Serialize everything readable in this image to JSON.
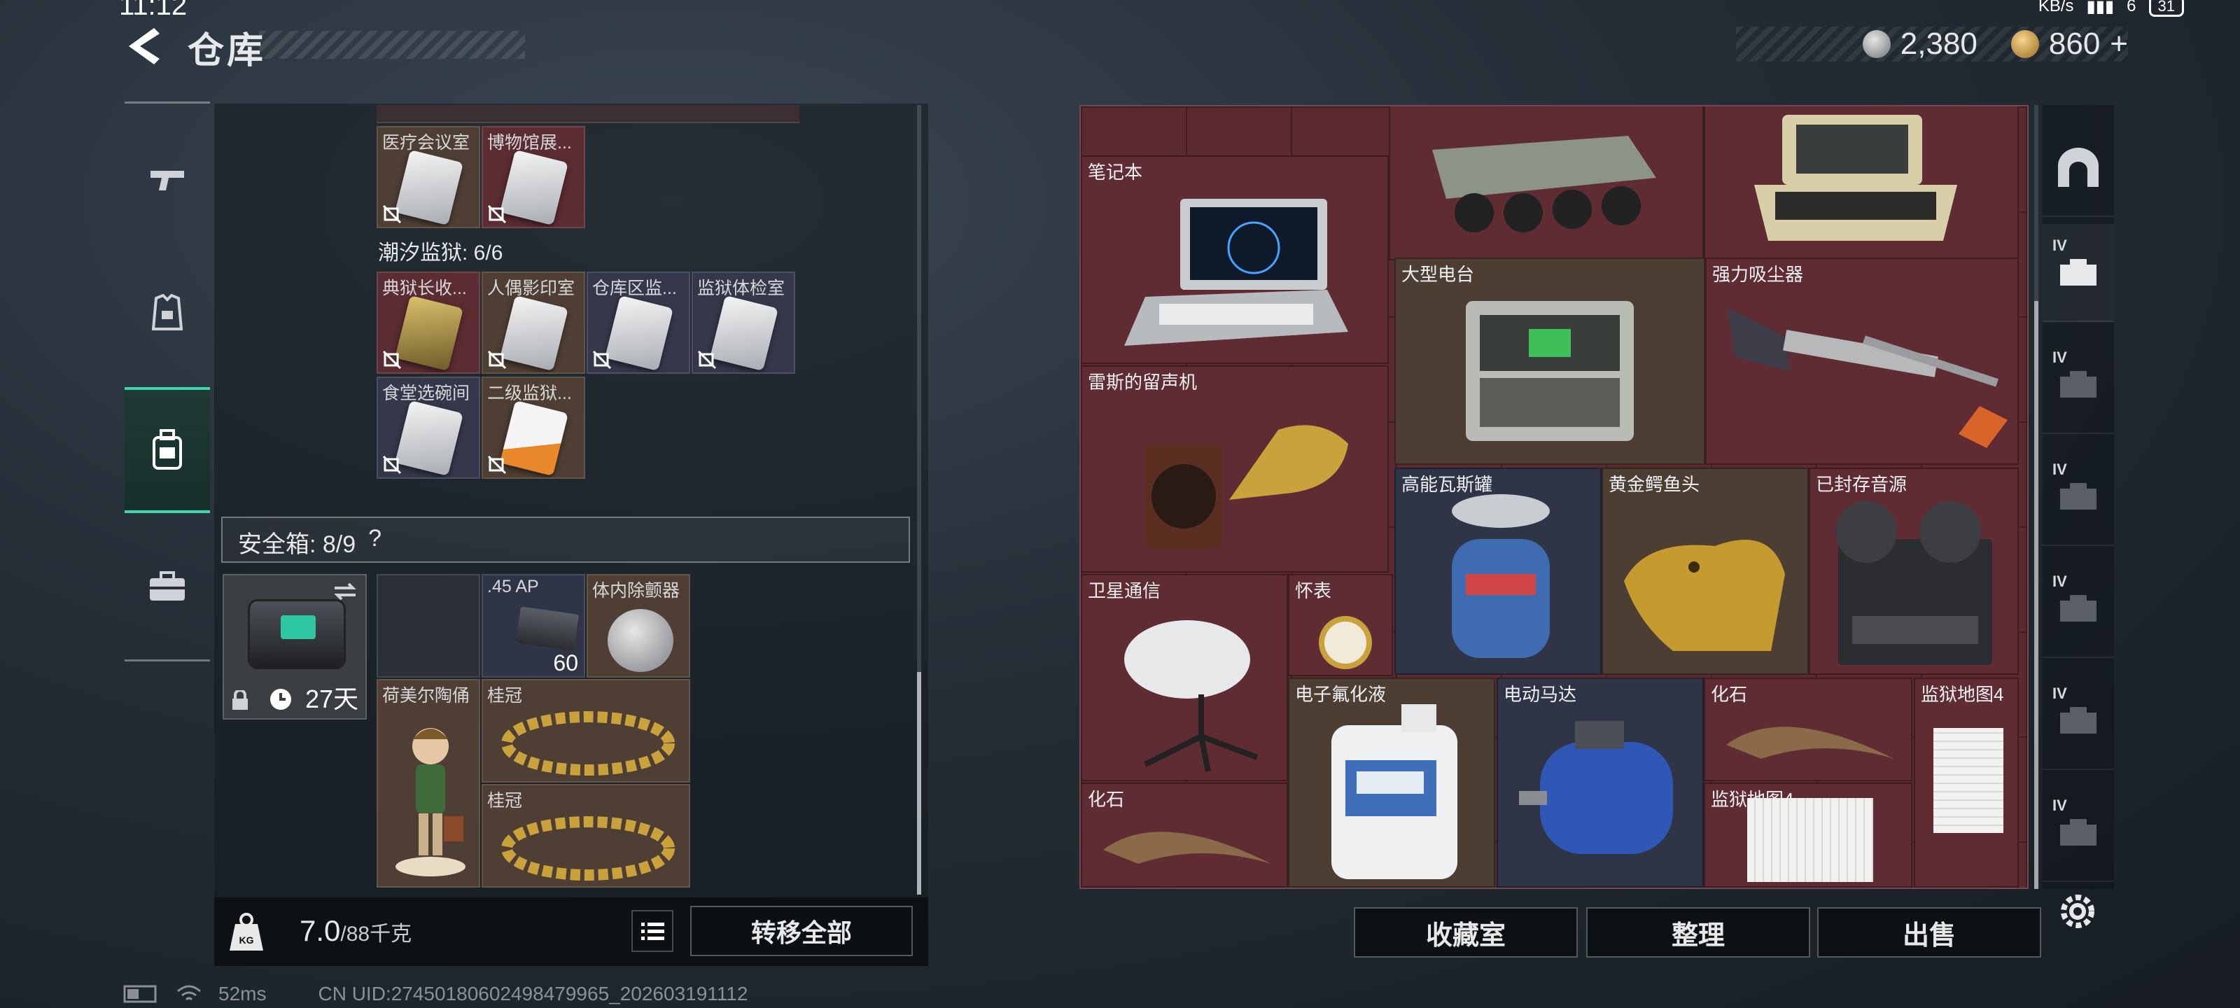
{
  "status": {
    "time": "11:12",
    "net": "KB/s",
    "signal_bars": "6",
    "battery": "31"
  },
  "header": {
    "title": "仓库"
  },
  "currency": {
    "silver": "2,380",
    "gold": "860",
    "gold_plus": "+"
  },
  "left_nav": {
    "items": [
      {
        "icon": "gun-icon"
      },
      {
        "icon": "armor-icon"
      },
      {
        "icon": "backpack-icon",
        "active": true
      },
      {
        "icon": "briefcase-icon"
      }
    ]
  },
  "keycards": {
    "top_row": [
      {
        "label": "医疗会议室",
        "color": "brown"
      },
      {
        "label": "博物馆展...",
        "color": "red"
      }
    ],
    "section_title": "潮汐监狱: 6/6",
    "prison_rows": [
      [
        {
          "label": "典狱长收...",
          "color": "red",
          "card": "gold"
        },
        {
          "label": "人偶影印室",
          "color": "brown",
          "card": "silver"
        },
        {
          "label": "仓库区监...",
          "color": "slate",
          "card": "silver"
        },
        {
          "label": "监狱体检室",
          "color": "slate",
          "card": "silver"
        }
      ],
      [
        {
          "label": "食堂选碗间",
          "color": "slate",
          "card": "silver"
        },
        {
          "label": "二级监狱...",
          "color": "brown",
          "card": "orange"
        }
      ]
    ]
  },
  "safebox": {
    "title": "安全箱: 8/9",
    "help": "?",
    "days": "27天",
    "items": [
      {
        "label": ".45 AP",
        "count": "60"
      },
      {
        "label": "体内除颤器"
      },
      {
        "label": "荷美尔陶俑"
      },
      {
        "label": "桂冠"
      },
      {
        "label": "桂冠"
      }
    ]
  },
  "weight": {
    "current": "7.0",
    "max": "/88千克"
  },
  "buttons": {
    "transfer_all": "转移全部",
    "collection": "收藏室",
    "organize": "整理",
    "sell": "出售"
  },
  "stash_items": [
    {
      "label": "笔记本"
    },
    {
      "label": "大型电台"
    },
    {
      "label": "强力吸尘器"
    },
    {
      "label": "雷斯的留声机"
    },
    {
      "label": "高能瓦斯罐"
    },
    {
      "label": "黄金鳄鱼头"
    },
    {
      "label": "已封存音源"
    },
    {
      "label": "卫星通信"
    },
    {
      "label": "怀表"
    },
    {
      "label": "电子氟化液"
    },
    {
      "label": "电动马达"
    },
    {
      "label": "化石"
    },
    {
      "label": "监狱地图4"
    },
    {
      "label": "化石"
    },
    {
      "label": "监狱地图4"
    }
  ],
  "right_rail": {
    "levels": [
      "IV",
      "IV",
      "IV",
      "IV",
      "IV",
      "IV"
    ]
  },
  "footer": {
    "ping": "52ms",
    "uid": "CN UID:27450180602498479965_202603191112"
  }
}
